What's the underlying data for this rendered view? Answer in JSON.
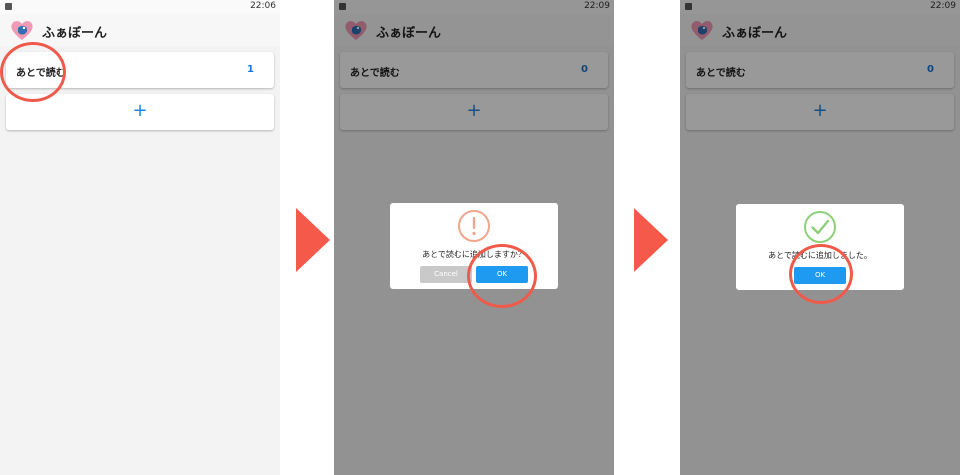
{
  "app": {
    "title": "ふぁぼーん"
  },
  "screens": [
    {
      "time": "22:06",
      "list_label": "あとで読む",
      "count": "1",
      "add_symbol": "+"
    },
    {
      "time": "22:09",
      "list_label": "あとで読む",
      "count": "0",
      "add_symbol": "+",
      "dialog": {
        "message": "あとで読むに追加しますか？",
        "cancel_label": "Cancel",
        "ok_label": "OK"
      }
    },
    {
      "time": "22:09",
      "list_label": "あとで読む",
      "count": "0",
      "add_symbol": "+",
      "dialog": {
        "message": "あとで読むに追加しました。",
        "ok_label": "OK"
      }
    }
  ],
  "colors": {
    "accent": "#1e9bf0",
    "highlight": "#f05a4a",
    "warning": "#f2a58a",
    "success": "#8ed07a"
  },
  "icons": [
    "app-logo-icon",
    "exclamation-circle-icon",
    "check-circle-icon",
    "next-arrow-icon"
  ]
}
